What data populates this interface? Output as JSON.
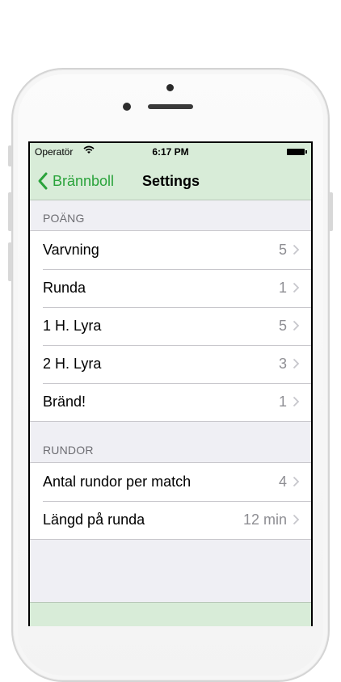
{
  "status_bar": {
    "carrier": "Operatör",
    "time": "6:17 PM"
  },
  "nav": {
    "back_label": "Brännboll",
    "title": "Settings"
  },
  "sections": [
    {
      "header": "POÄNG",
      "rows": [
        {
          "label": "Varvning",
          "value": "5"
        },
        {
          "label": "Runda",
          "value": "1"
        },
        {
          "label": "1 H. Lyra",
          "value": "5"
        },
        {
          "label": "2 H. Lyra",
          "value": "3"
        },
        {
          "label": "Bränd!",
          "value": "1"
        }
      ]
    },
    {
      "header": "RUNDOR",
      "rows": [
        {
          "label": "Antal rundor per match",
          "value": "4"
        },
        {
          "label": "Längd på runda",
          "value": "12 min"
        }
      ]
    }
  ],
  "colors": {
    "accent": "#2aa33b",
    "nav_background": "#d8ecd8",
    "table_background": "#efeff4"
  }
}
